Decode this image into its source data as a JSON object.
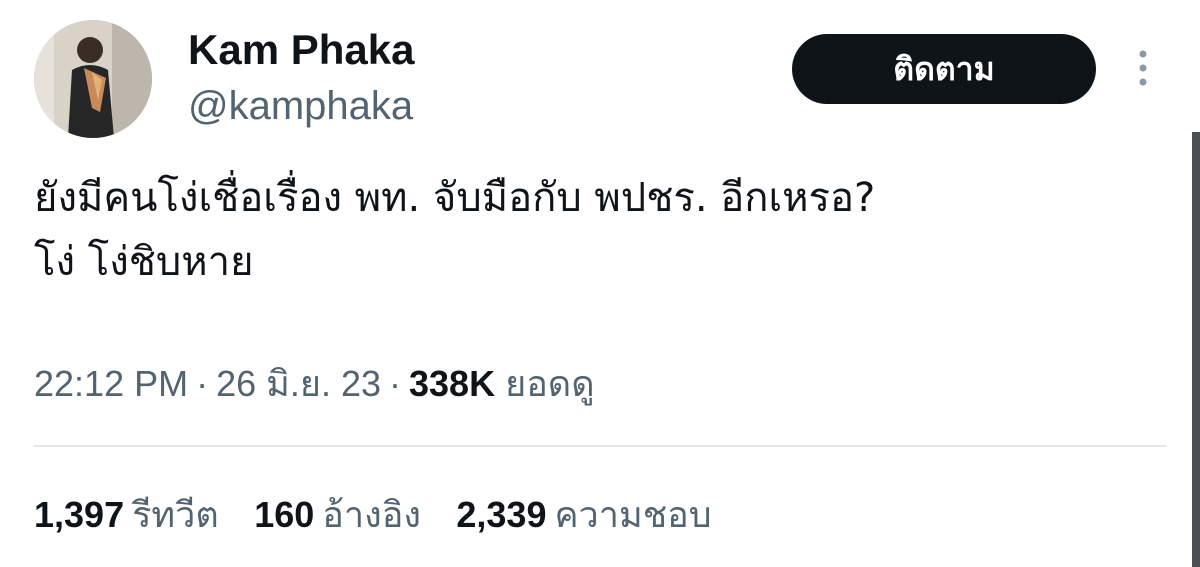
{
  "user": {
    "display_name": "Kam Phaka",
    "handle": "@kamphaka"
  },
  "follow_button_label": "ติดตาม",
  "more_icon": "more-vertical-icon",
  "tweet": {
    "lines": [
      "ยังมีคนโง่เชื่อเรื่อง พท. จับมือกับ พปชร. อีกเหรอ?",
      "โง่ โง่ชิบหาย"
    ]
  },
  "meta": {
    "time": "22:12 PM",
    "separator": "·",
    "date": "26 มิ.ย. 23",
    "views_count": "338K",
    "views_label": "ยอดดู"
  },
  "stats": [
    {
      "count": "1,397",
      "label": "รีทวีต"
    },
    {
      "count": "160",
      "label": "อ้างอิง"
    },
    {
      "count": "2,339",
      "label": "ความชอบ"
    }
  ],
  "colors": {
    "text_primary": "#0f1419",
    "text_secondary": "#536471",
    "button_background": "#0f1419",
    "button_text": "#ffffff",
    "divider": "#e3e6e8"
  }
}
